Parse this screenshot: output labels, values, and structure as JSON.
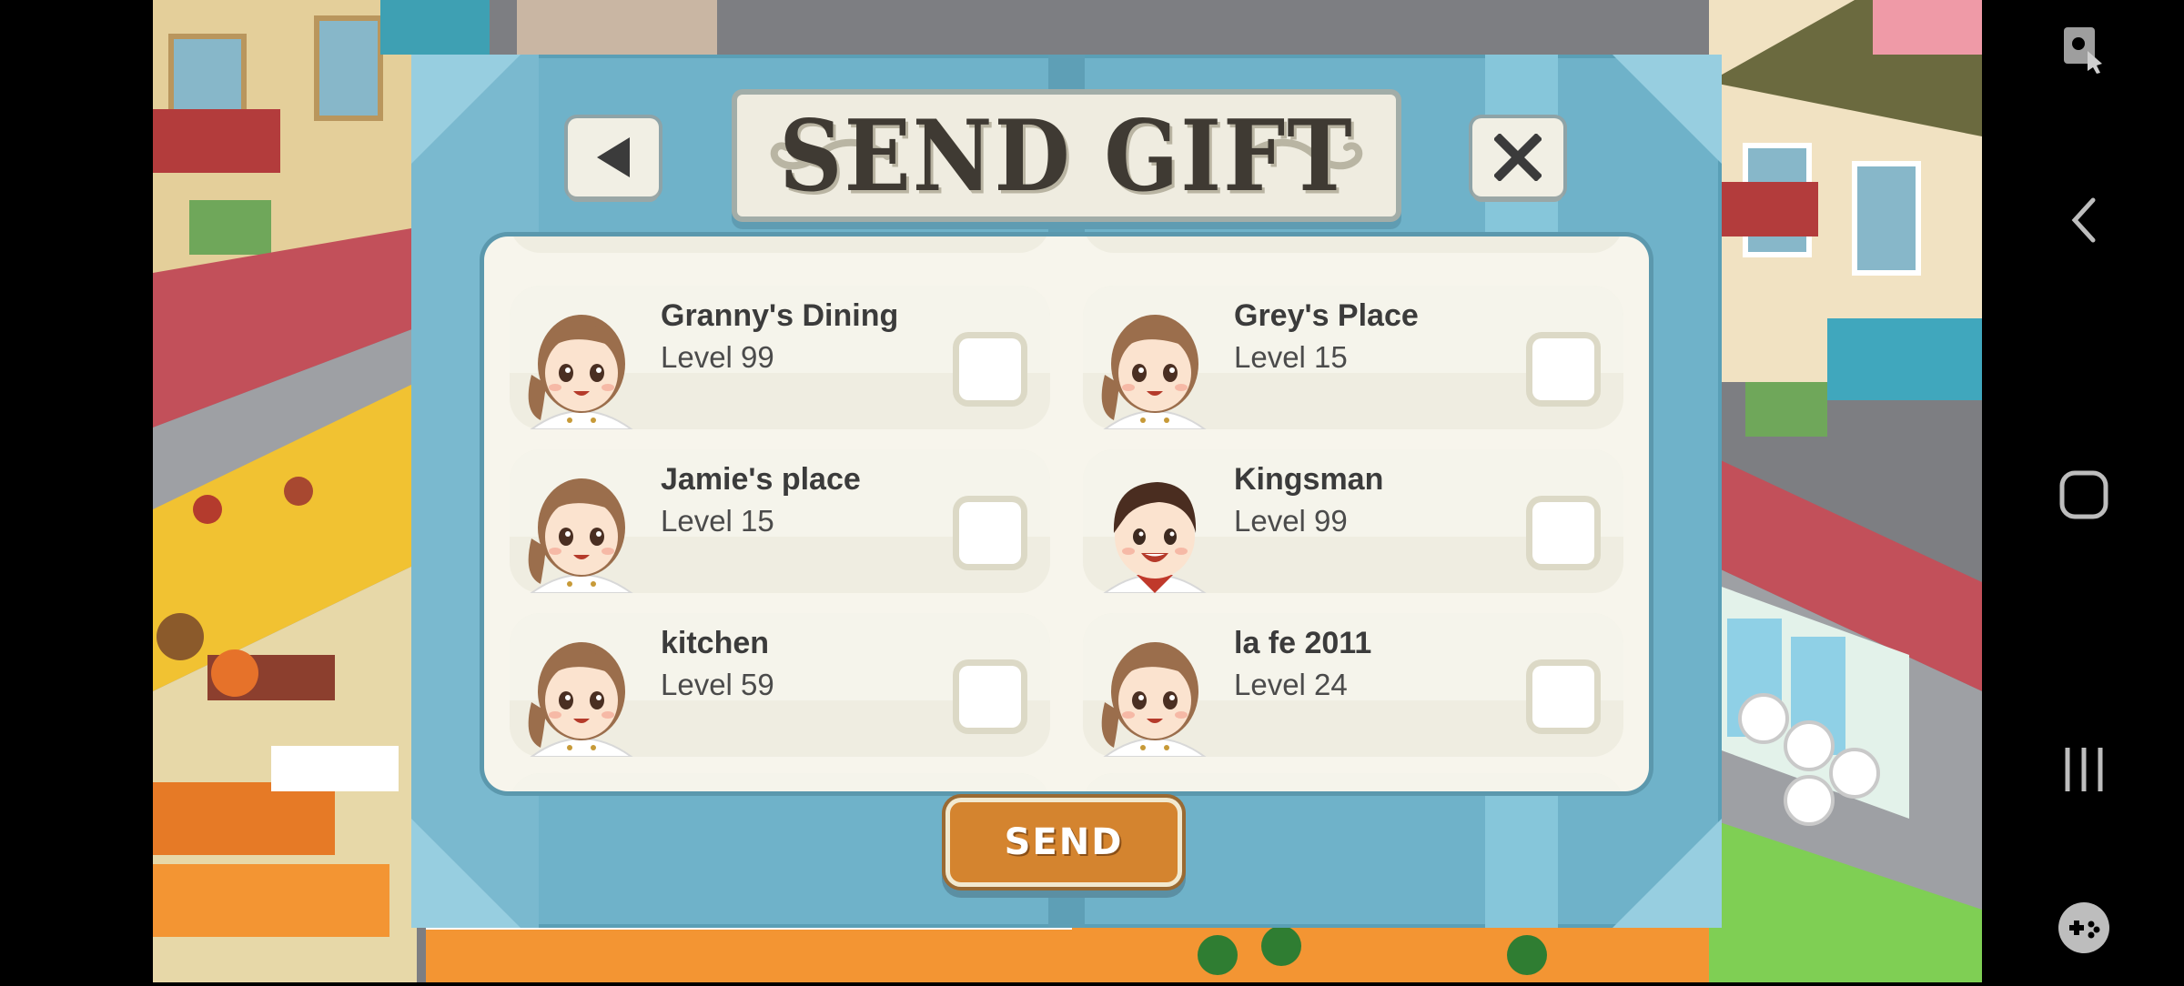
{
  "dialog": {
    "title": "SEND GIFT",
    "send_label": "SEND"
  },
  "friends": [
    {
      "name": "Granny's Dining",
      "level": "Level 99",
      "avatar": "female-chef",
      "checked": false
    },
    {
      "name": "Grey's Place",
      "level": "Level 15",
      "avatar": "female-chef",
      "checked": false
    },
    {
      "name": "Jamie's place",
      "level": "Level 15",
      "avatar": "female-chef",
      "checked": false
    },
    {
      "name": "Kingsman",
      "level": "Level 99",
      "avatar": "male-chef",
      "checked": false
    },
    {
      "name": "kitchen",
      "level": "Level 59",
      "avatar": "female-chef",
      "checked": false
    },
    {
      "name": "la fe 2011",
      "level": "Level 24",
      "avatar": "female-chef",
      "checked": false
    }
  ],
  "icons": {
    "back": "back-arrow-icon",
    "close": "close-x-icon",
    "system": [
      "screen-record-icon",
      "nav-back-icon",
      "nav-home-icon",
      "nav-recents-icon",
      "game-tools-icon"
    ]
  },
  "colors": {
    "dialog_bg": "#6fb2c9",
    "panel_bg": "#f7f5ec",
    "send_button": "#d4842f",
    "title_text": "#3f3a33"
  }
}
